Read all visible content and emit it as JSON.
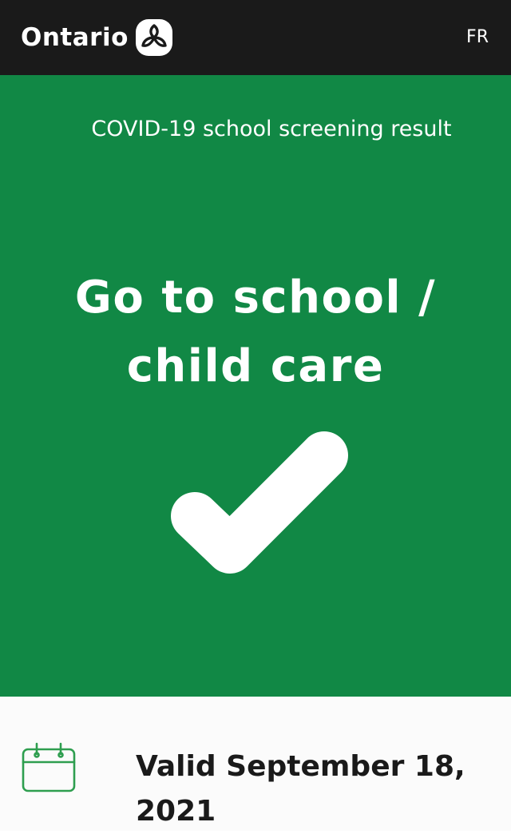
{
  "header": {
    "logo_text": "Ontario",
    "logo_icon": "trillium-icon",
    "language_toggle": "FR"
  },
  "result": {
    "subtitle": "COVID-19 school screening result",
    "headline": "Go to school / child care",
    "status_icon": "checkmark-icon",
    "background_color": "#118845"
  },
  "validity": {
    "icon": "calendar-icon",
    "text": "Valid September 18, 2021",
    "icon_color": "#2e9e4f"
  },
  "colors": {
    "header_bg": "#1a1a1a",
    "accent_green": "#118845"
  }
}
